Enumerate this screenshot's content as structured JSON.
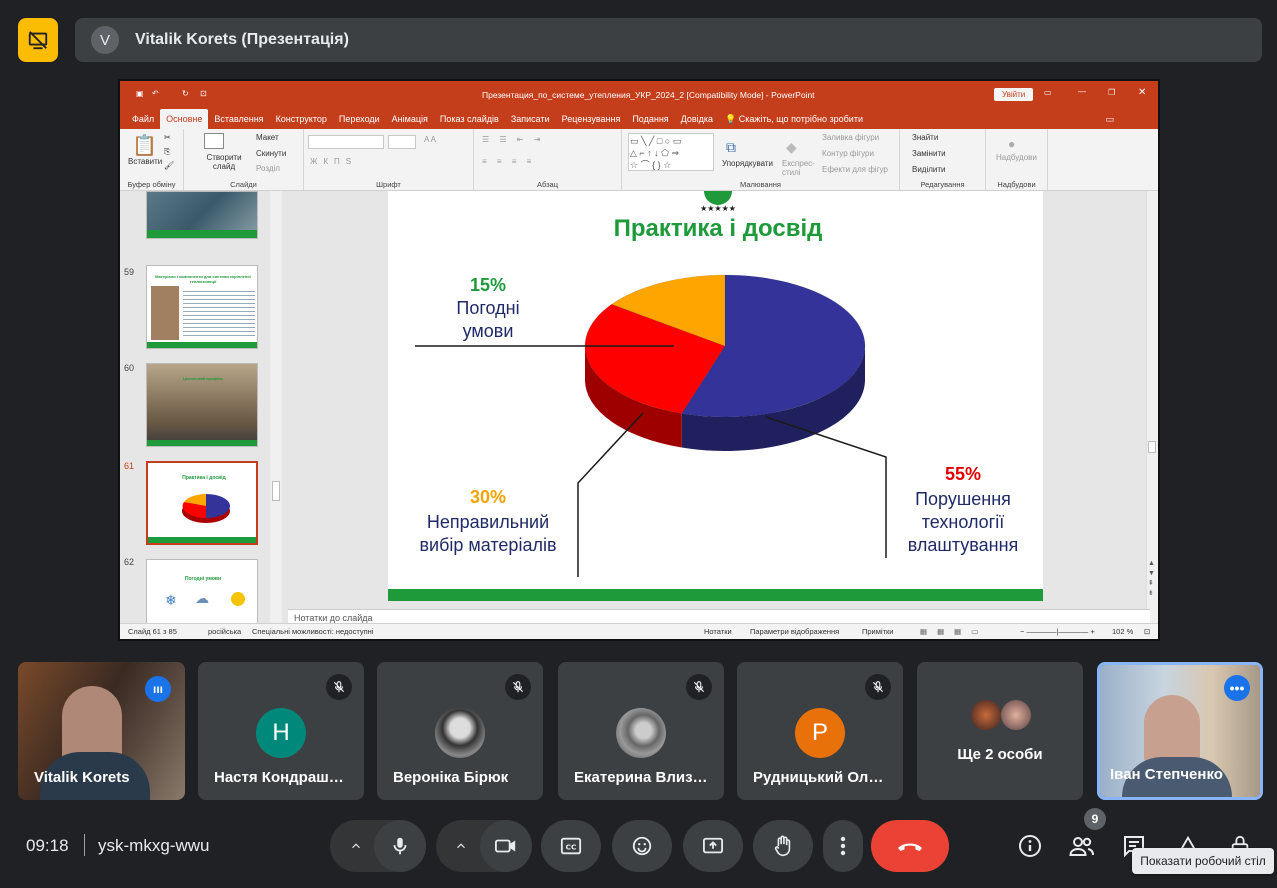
{
  "header": {
    "avatar_letter": "V",
    "title": "Vitalik Korets (Презентація)"
  },
  "ppt": {
    "window_title": "Презентация_по_системе_утепления_УКР_2024_2 [Compatibility Mode]  -  PowerPoint",
    "signin_label": "Увійти",
    "tabs": [
      "Файл",
      "Основне",
      "Вставлення",
      "Конструктор",
      "Переходи",
      "Анімація",
      "Показ слайдів",
      "Записати",
      "Рецензування",
      "Подання",
      "Довідка"
    ],
    "tell_me": "Скажіть, що потрібно зробити",
    "ribbon": {
      "paste": "Вставити",
      "clipboard_group": "Буфер обміну",
      "new_slide": "Створити слайд",
      "layout": "Макет",
      "reset": "Скинути",
      "section": "Розділ",
      "slides_group": "Слайди",
      "font_group": "Шрифт",
      "paragraph_group": "Абзац",
      "arrange": "Упорядкувати",
      "quick_styles": "Експрес-стилі",
      "shape_fill": "Заливка фігури",
      "shape_outline": "Контур фігури",
      "shape_effects": "Ефекти для фігур",
      "drawing_group": "Малювання",
      "find": "Знайти",
      "replace": "Замінити",
      "select": "Виділити",
      "editing_group": "Редагування",
      "addins": "Надбудови",
      "addins_group": "Надбудови"
    },
    "thumbnails": [
      {
        "num": "",
        "title": ""
      },
      {
        "num": "59",
        "title": "Матеріали і компоненти для системи скріпленої теплоізоляції"
      },
      {
        "num": "60",
        "title": "Цокольний профіль"
      },
      {
        "num": "61",
        "title": "Практика і досвід"
      },
      {
        "num": "62",
        "title": "Погодні умови"
      }
    ],
    "notes_placeholder": "Нотатки до слайда",
    "status": {
      "slide_counter": "Слайд 61 з 85",
      "language": "російська",
      "accessibility": "Спеціальні можливості: недоступні",
      "notes": "Нотатки",
      "view_settings": "Параметри відображення",
      "comments": "Примітки",
      "zoom": "102 %"
    }
  },
  "slide": {
    "title": "Практика і досвід",
    "labels": [
      {
        "pct": "15%",
        "text": "Погодні умови"
      },
      {
        "pct": "30%",
        "text": "Неправильний вибір матеріалів"
      },
      {
        "pct": "55%",
        "text": "Порушення технології влаштування"
      }
    ]
  },
  "chart_data": {
    "type": "pie",
    "title": "Практика і досвід",
    "categories": [
      "Погодні умови",
      "Неправильний вибір матеріалів",
      "Порушення технології влаштування"
    ],
    "values": [
      15,
      30,
      55
    ],
    "colors": [
      "#ffa500",
      "#ff0000",
      "#333399"
    ],
    "legend": "none"
  },
  "participants": [
    {
      "name": "Vitalik Korets",
      "kind": "video",
      "speaking": true
    },
    {
      "name": "Настя Кондраш…",
      "kind": "initial",
      "initial": "Н",
      "color": "#00897b",
      "muted": true
    },
    {
      "name": "Вероніка Бірюк",
      "kind": "photo",
      "muted": true
    },
    {
      "name": "Екатерина Влиз…",
      "kind": "photo",
      "muted": true
    },
    {
      "name": "Рудницький Ол…",
      "kind": "initial",
      "initial": "Р",
      "color": "#e8710a",
      "muted": true
    },
    {
      "name": "Ще 2 особи",
      "kind": "group"
    },
    {
      "name": "Іван Степченко",
      "kind": "video",
      "pinned": true
    }
  ],
  "bottom": {
    "time": "09:18",
    "meeting_code": "ysk-mkxg-wwu",
    "people_count": "9",
    "tooltip": "Показати робочий стіл"
  },
  "colors": {
    "accent_yellow": "#fbbc04",
    "end_call": "#ea4335",
    "ppt_red": "#c43e1c",
    "slide_green": "#1f9a3b"
  }
}
